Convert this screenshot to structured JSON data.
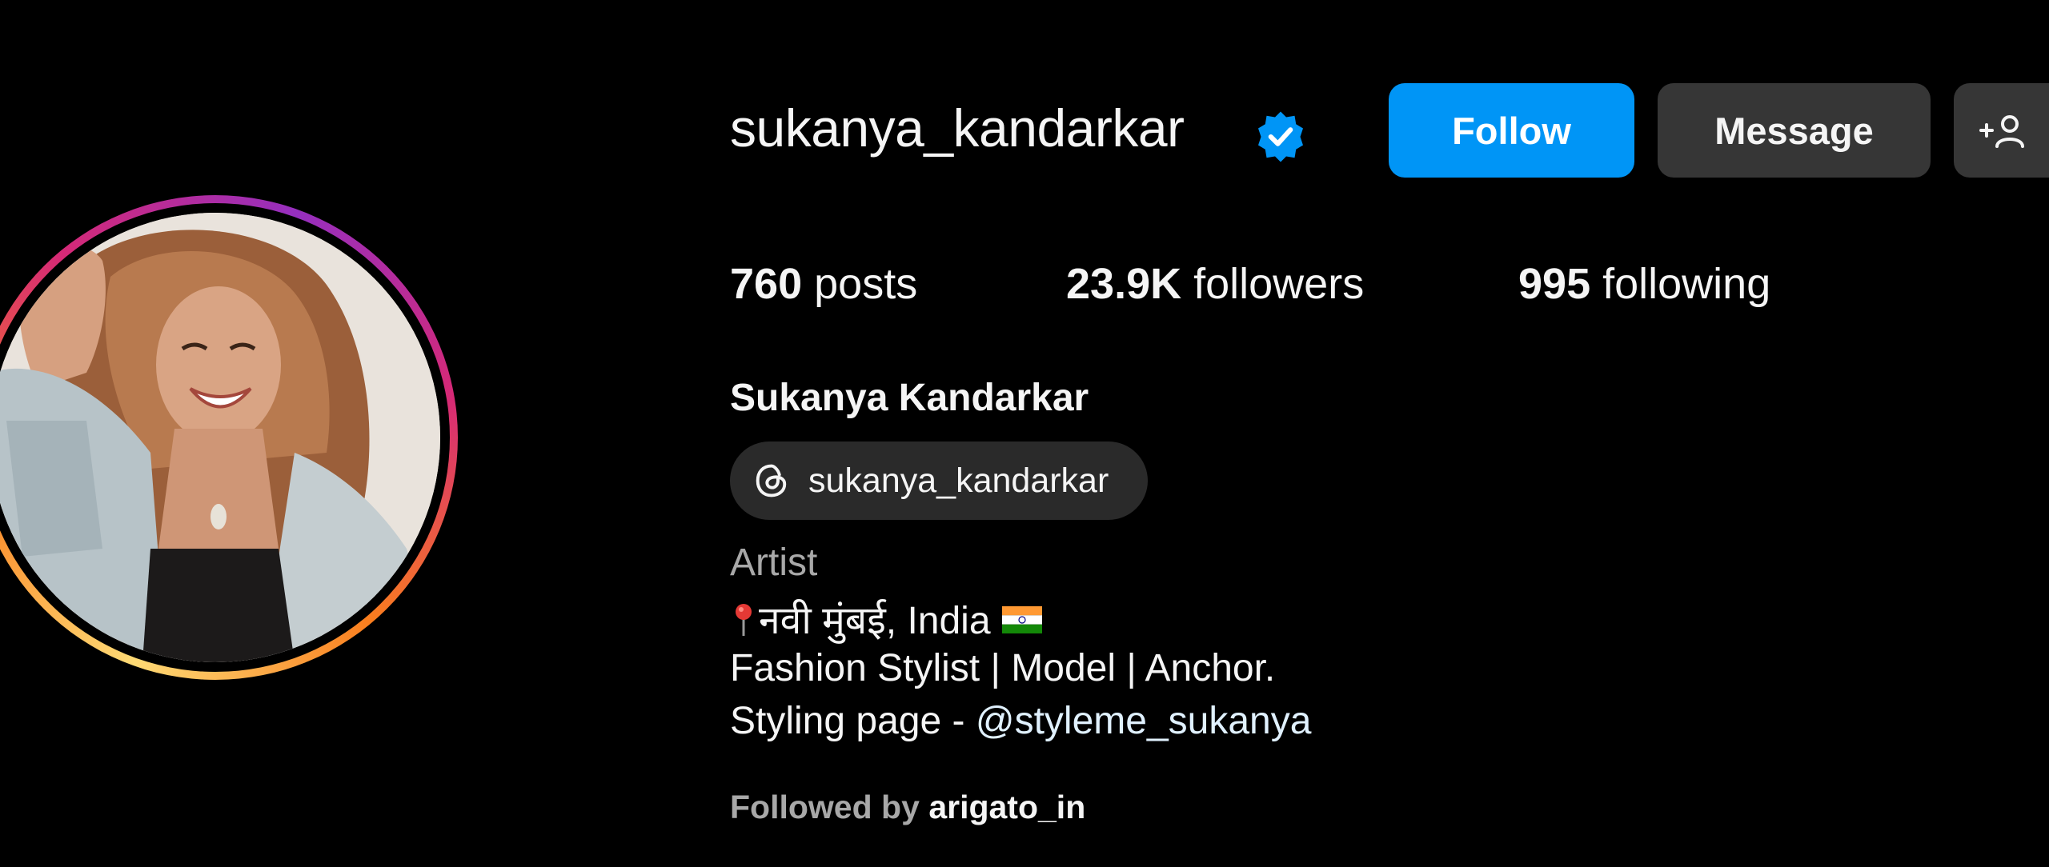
{
  "profile": {
    "username": "sukanya_kandarkar",
    "full_name": "Sukanya Kandarkar",
    "verified": true,
    "avatar_ring_colors": [
      "#feda75",
      "#fa7e1e",
      "#d62976",
      "#962fbf"
    ]
  },
  "actions": {
    "follow_label": "Follow",
    "message_label": "Message",
    "suggest_label": "+",
    "follow_color": "#0095f6",
    "secondary_color": "#363636"
  },
  "stats": {
    "posts_count": "760",
    "posts_label": "posts",
    "followers_count": "23.9K",
    "followers_label": "followers",
    "following_count": "995",
    "following_label": "following"
  },
  "threads": {
    "handle": "sukanya_kandarkar",
    "icon": "threads-icon"
  },
  "bio": {
    "category": "Artist",
    "location_text": "नवी मुंबई, India",
    "location_icon": "pin-icon",
    "flag_icon": "india-flag-icon",
    "line2": "Fashion Stylist | Model | Anchor.",
    "line3_prefix": "Styling page - ",
    "line3_mention": "@styleme_sukanya"
  },
  "followed_by": {
    "prefix": "Followed by",
    "name": "arigato_in"
  }
}
